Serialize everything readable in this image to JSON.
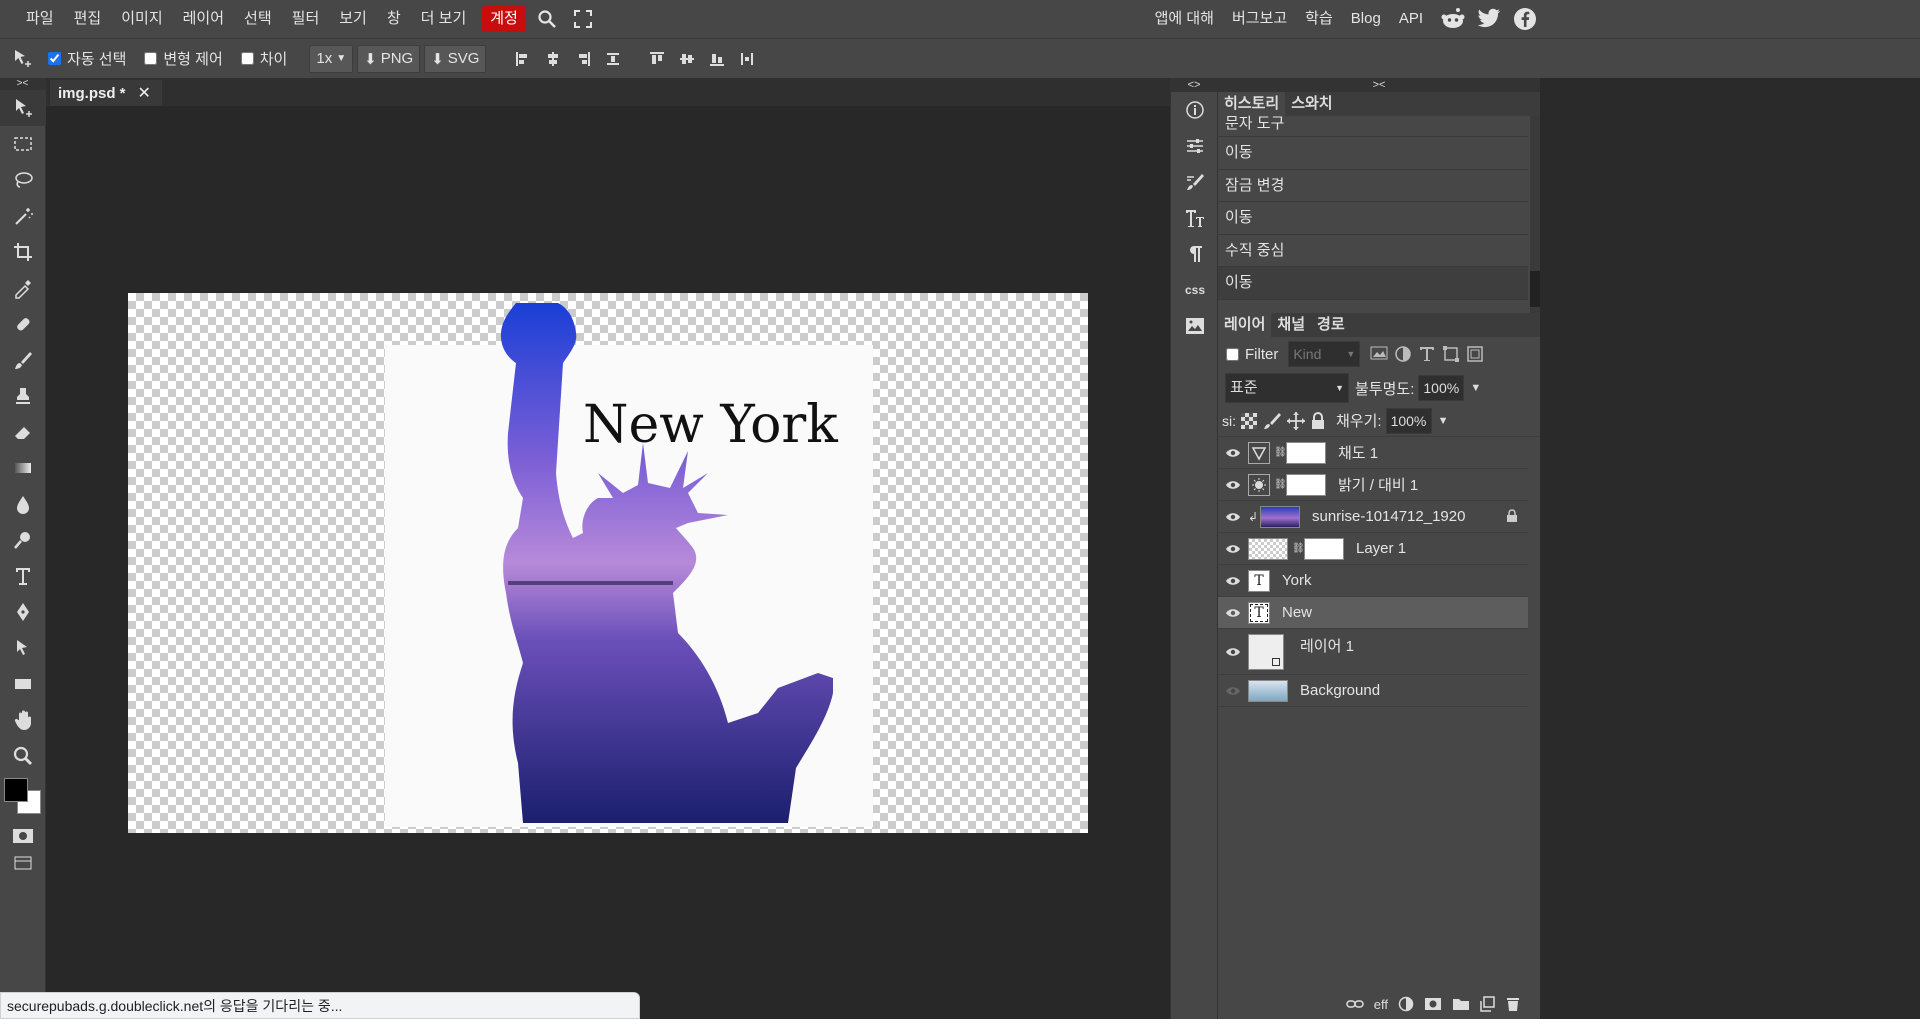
{
  "menu": {
    "items": [
      "파일",
      "편집",
      "이미지",
      "레이어",
      "선택",
      "필터",
      "보기",
      "창",
      "더 보기"
    ],
    "account": "계정",
    "right": [
      "앱에 대해",
      "버그보고",
      "학습",
      "Blog",
      "API"
    ]
  },
  "options": {
    "auto_select": "자동 선택",
    "transform": "변형 제어",
    "diff": "차이",
    "zoom": "1x",
    "png": "PNG",
    "svg": "SVG"
  },
  "document": {
    "tab_title": "img.psd *",
    "canvas_text": "New York"
  },
  "history": {
    "tabs": [
      "히스토리",
      "스와치"
    ],
    "items": [
      "문자 도구",
      "이동",
      "잠금 변경",
      "이동",
      "수직 중심",
      "이동"
    ]
  },
  "layers_panel": {
    "tabs": [
      "레이어",
      "채널",
      "경로"
    ],
    "filter_label": "Filter",
    "kind_placeholder": "Kind",
    "blend_mode": "표준",
    "opacity_label": "불투명도:",
    "opacity_value": "100%",
    "lock_label": "si:",
    "fill_label": "채우기:",
    "fill_value": "100%",
    "layers": [
      {
        "name": "채도 1"
      },
      {
        "name": "밝기 / 대비 1"
      },
      {
        "name": "sunrise-1014712_1920"
      },
      {
        "name": "Layer 1"
      },
      {
        "name": "York"
      },
      {
        "name": "New"
      },
      {
        "name": "레이어 1"
      },
      {
        "name": "Background"
      }
    ],
    "footer_eff": "eff"
  },
  "status": {
    "text": "securepubads.g.doubleclick.net의 응답을 기다리는 중..."
  },
  "colors": {
    "accent": "#c70d0d",
    "panel": "#474747",
    "canvas_bg": "#282828",
    "selected_layer": "#5d5d5d"
  },
  "icons": [
    "move-icon",
    "marquee-icon",
    "lasso-icon",
    "magic-wand-icon",
    "crop-icon",
    "eyedropper-icon",
    "healing-icon",
    "brush-icon",
    "stamp-icon",
    "eraser-icon",
    "gradient-icon",
    "blur-icon",
    "dodge-icon",
    "type-icon",
    "pen-icon",
    "path-select-icon",
    "shape-icon",
    "hand-icon",
    "zoom-icon",
    "search-icon",
    "fullscreen-icon",
    "reddit-icon",
    "twitter-icon",
    "facebook-icon"
  ]
}
